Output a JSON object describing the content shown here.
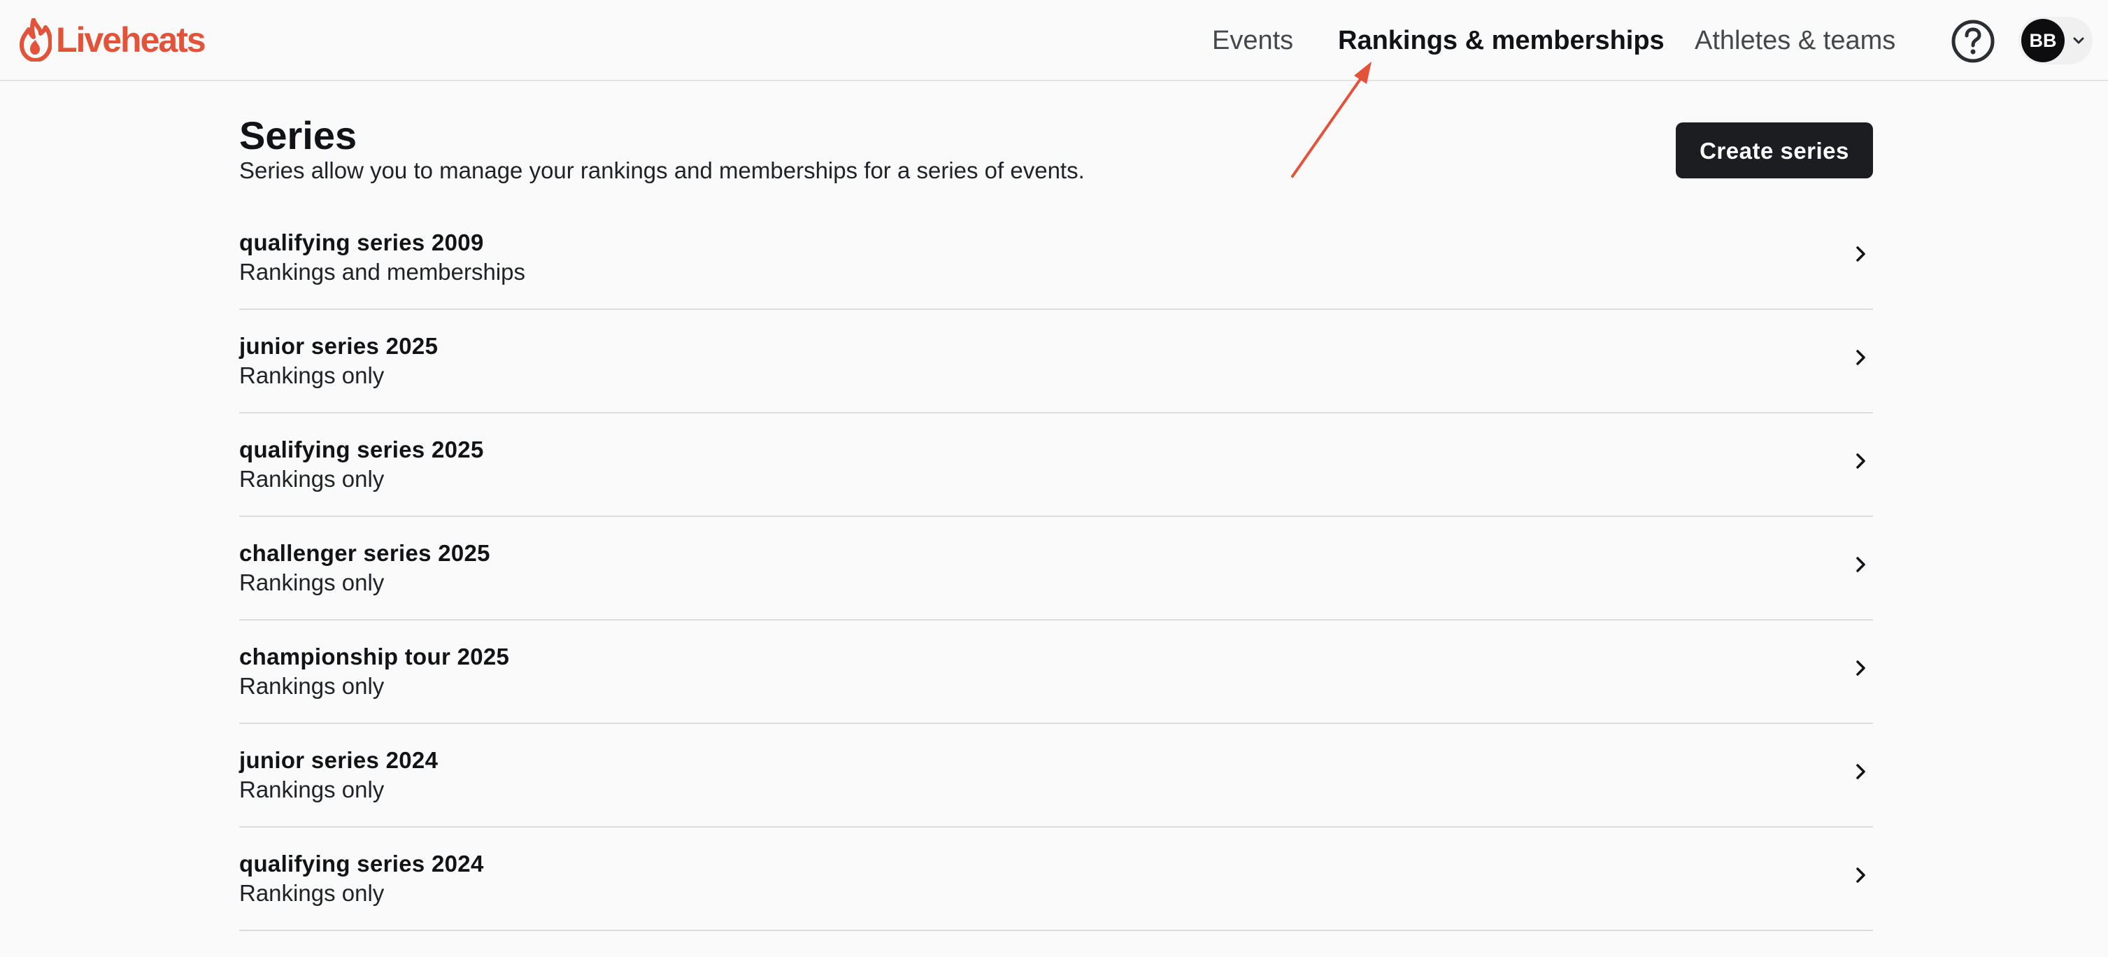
{
  "header": {
    "logo_text": "Liveheats",
    "brand_color": "#e2533a",
    "nav": {
      "events": "Events",
      "rankings": "Rankings & memberships",
      "athletes": "Athletes & teams"
    },
    "help_icon": "help-circle-icon",
    "avatar_initials": "BB"
  },
  "main": {
    "title": "Series",
    "subtitle": "Series allow you to manage your rankings and memberships for a series of events.",
    "create_button": "Create series",
    "series": [
      {
        "name": "qualifying series 2009",
        "type": "Rankings and memberships"
      },
      {
        "name": "junior series 2025",
        "type": "Rankings only"
      },
      {
        "name": "qualifying series 2025",
        "type": "Rankings only"
      },
      {
        "name": "challenger series 2025",
        "type": "Rankings only"
      },
      {
        "name": "championship tour 2025",
        "type": "Rankings only"
      },
      {
        "name": "junior series 2024",
        "type": "Rankings only"
      },
      {
        "name": "qualifying series 2024",
        "type": "Rankings only"
      }
    ]
  },
  "annotation_color": "#e2533a"
}
